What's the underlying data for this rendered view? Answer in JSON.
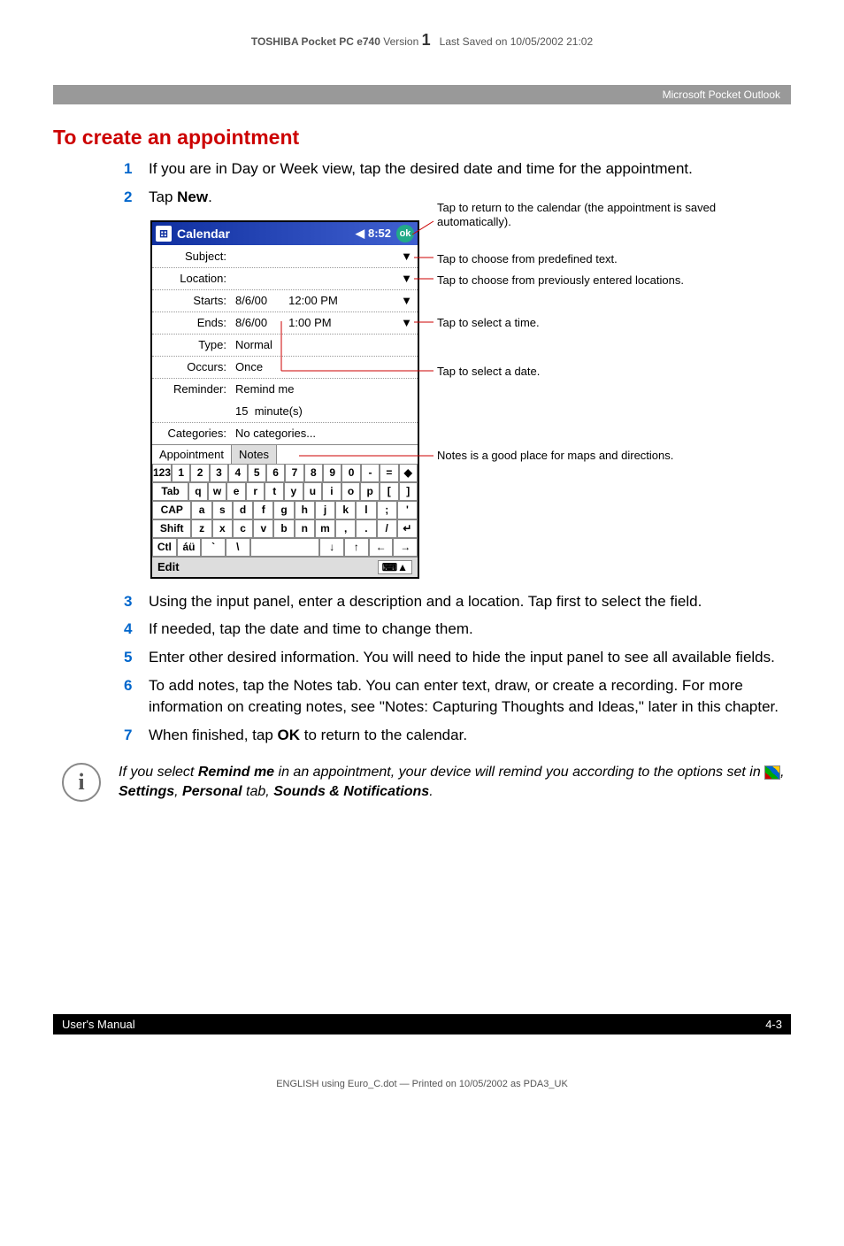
{
  "header": {
    "product": "TOSHIBA Pocket PC e740",
    "version_label": "Version",
    "version": "1",
    "saved": "Last Saved on 10/05/2002 21:02"
  },
  "chapter_bar": "Microsoft Pocket Outlook",
  "section_title": "To create an appointment",
  "steps": {
    "s1": "If you are in Day or Week view, tap the desired date and time for the appointment.",
    "s2_a": "Tap ",
    "s2_b": "New",
    "s3": "Using the input panel, enter a description and a location. Tap first to select the field.",
    "s4": "If needed, tap the date and time to change them.",
    "s5": "Enter other desired information. You will need to hide the input panel to see all available fields.",
    "s6": "To add notes, tap the Notes tab. You can enter text, draw, or create a recording. For more information on creating notes, see \"Notes: Capturing Thoughts and Ideas,\" later in this chapter.",
    "s7_a": "When finished, tap ",
    "s7_b": "OK",
    "s7_c": " to return to the calendar."
  },
  "pda": {
    "title": "Calendar",
    "clock": "8:52",
    "sound_icon": "◀",
    "ok": "ok",
    "subject_label": "Subject:",
    "subject_value": "",
    "location_label": "Location:",
    "location_value": "",
    "starts_label": "Starts:",
    "starts_date": "8/6/00",
    "starts_time": "12:00 PM",
    "ends_label": "Ends:",
    "ends_date": "8/6/00",
    "ends_time": "1:00 PM",
    "type_label": "Type:",
    "type_value": "Normal",
    "occurs_label": "Occurs:",
    "occurs_value": "Once",
    "reminder_label": "Reminder:",
    "reminder_value": "Remind me",
    "reminder_qty": "15",
    "reminder_unit": "minute(s)",
    "categories_label": "Categories:",
    "categories_value": "No categories...",
    "tab_appointment": "Appointment",
    "tab_notes": "Notes",
    "edit": "Edit"
  },
  "keys": {
    "r1": [
      "123",
      "1",
      "2",
      "3",
      "4",
      "5",
      "6",
      "7",
      "8",
      "9",
      "0",
      "-",
      "=",
      "◆"
    ],
    "r2": [
      "Tab",
      "q",
      "w",
      "e",
      "r",
      "t",
      "y",
      "u",
      "i",
      "o",
      "p",
      "[",
      "]"
    ],
    "r3": [
      "CAP",
      "a",
      "s",
      "d",
      "f",
      "g",
      "h",
      "j",
      "k",
      "l",
      ";",
      "'"
    ],
    "r4": [
      "Shift",
      "z",
      "x",
      "c",
      "v",
      "b",
      "n",
      "m",
      ",",
      ".",
      "/",
      "↵"
    ],
    "r5": [
      "Ctl",
      "áü",
      "`",
      "\\",
      "",
      "↓",
      "↑",
      "←",
      "→"
    ]
  },
  "callouts": {
    "c1": "Tap to return to the calendar (the appointment is saved automatically).",
    "c2": "Tap to choose from predefined text.",
    "c3": "Tap to choose from previously entered locations.",
    "c4": "Tap to select a time.",
    "c5": "Tap to select a date.",
    "c6": "Notes is a good place for maps and directions."
  },
  "note": {
    "p1": "If you select ",
    "b1": "Remind me",
    "p2": " in an appointment, your device will remind you according to the options set in ",
    "p3": ", ",
    "b2": "Settings",
    "p4": ", ",
    "b3": "Personal",
    "p5": " tab, ",
    "b4": "Sounds & Notifications",
    "p6": "."
  },
  "footer": {
    "left": "User's Manual",
    "right": "4-3"
  },
  "foot_line": "ENGLISH using  Euro_C.dot — Printed on 10/05/2002 as PDA3_UK"
}
